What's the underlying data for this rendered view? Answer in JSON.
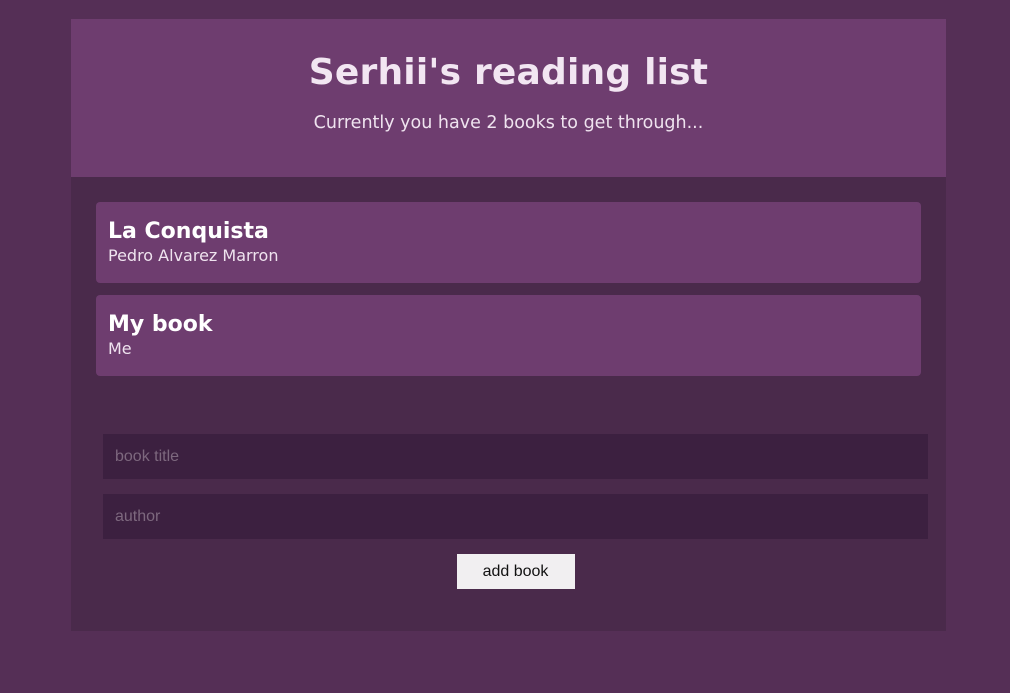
{
  "header": {
    "title": "Serhii's reading list",
    "subtitle": "Currently you have 2 books to get through..."
  },
  "books": [
    {
      "title": "La Conquista",
      "author": "Pedro Alvarez Marron"
    },
    {
      "title": "My book",
      "author": "Me"
    }
  ],
  "form": {
    "title_placeholder": "book title",
    "author_placeholder": "author",
    "submit_label": "add book"
  },
  "colors": {
    "page_bg": "#552f56",
    "container_bg": "#4a2a4b",
    "card_bg": "#6e3d6f",
    "input_bg": "#3c2040",
    "button_bg": "#f1eff1"
  }
}
